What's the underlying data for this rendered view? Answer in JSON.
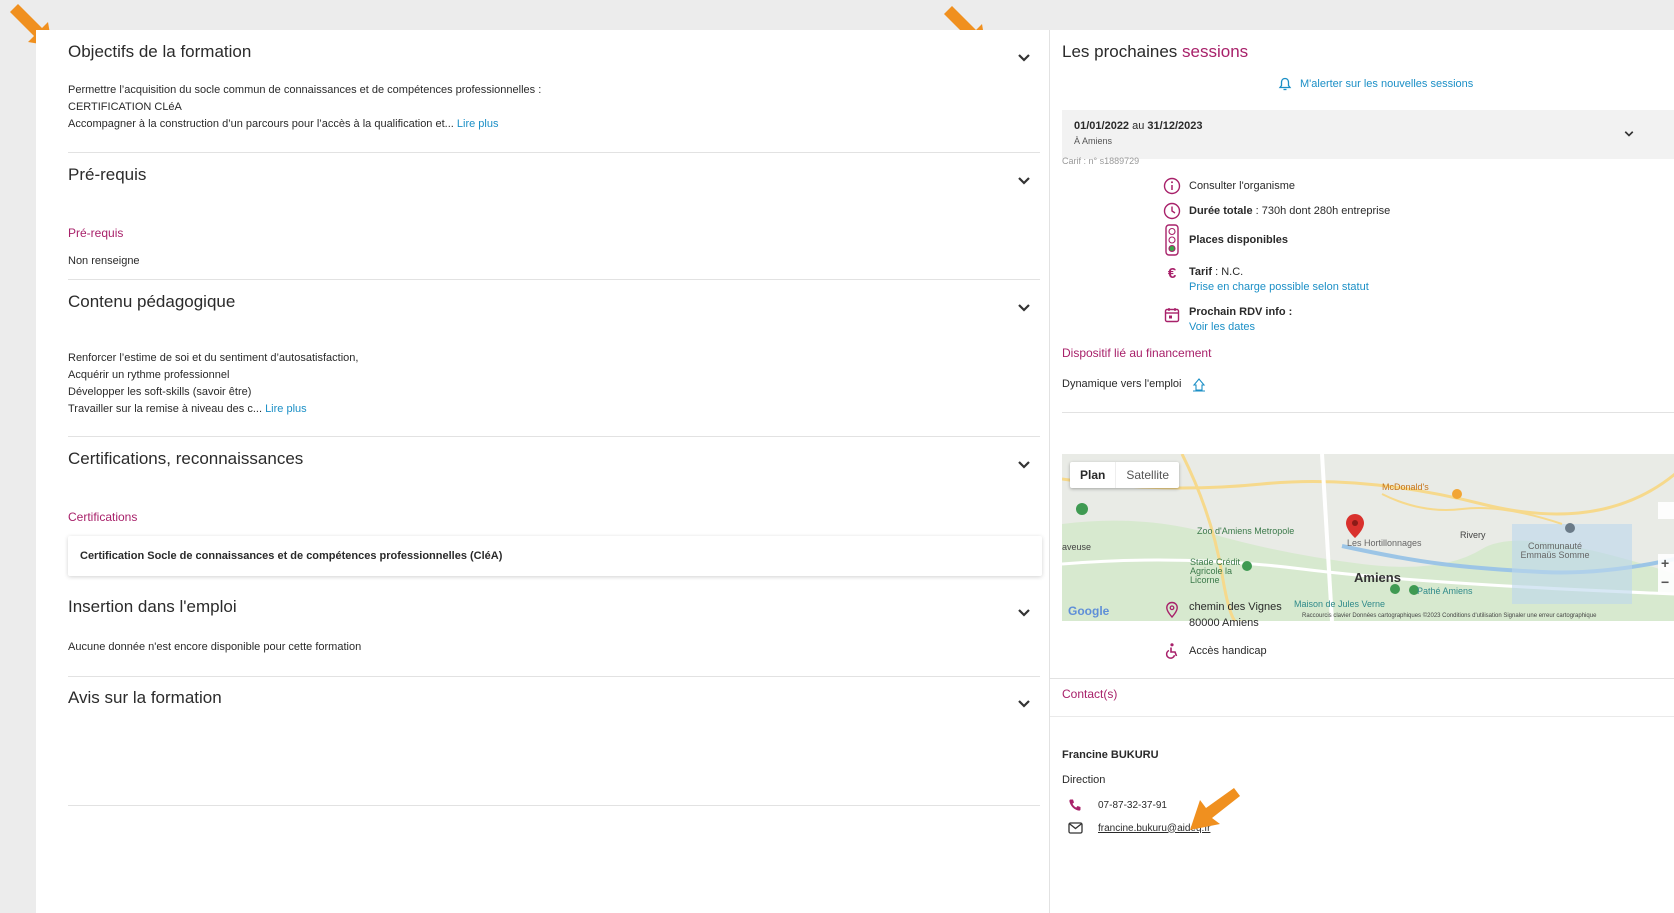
{
  "left": {
    "objectifs": {
      "title": "Objectifs de la formation",
      "line1": "Permettre l’acquisition du socle commun de connaissances et de compétences professionnelles :",
      "line2": "CERTIFICATION CLéA",
      "line3": "Accompagner à la construction d’un parcours pour l’accès à la qualification et...",
      "read_more": "Lire plus"
    },
    "prerequis": {
      "title": "Pré-requis",
      "subtitle": "Pré-requis",
      "value": "Non renseigne"
    },
    "contenu": {
      "title": "Contenu pédagogique",
      "line1": "Renforcer l’estime de soi et du sentiment d’autosatisfaction,",
      "line2": "Acquérir un rythme professionnel",
      "line3": "Développer les soft-skills (savoir être)",
      "line4": "Travailler sur la remise à niveau des c...",
      "read_more": "Lire plus"
    },
    "certifications": {
      "title": "Certifications, reconnaissances",
      "subtitle": "Certifications",
      "card": "Certification Socle de connaissances et de compétences professionnelles (CléA)"
    },
    "insertion": {
      "title": "Insertion dans l'emploi",
      "text": "Aucune donnée n'est encore disponible pour cette formation"
    },
    "avis": {
      "title": "Avis sur la formation"
    }
  },
  "right": {
    "title_part1": "Les prochaines ",
    "title_part2": "sessions",
    "alert_link": "M'alerter sur les nouvelles sessions",
    "session": {
      "date_start": "01/01/2022",
      "date_sep": " au ",
      "date_end": "31/12/2023",
      "location": "À Amiens"
    },
    "carif": "Carif : n° s1889729",
    "consulter": "Consulter l'organisme",
    "duree_label": "Durée totale",
    "duree_value": " : 730h dont 280h entreprise",
    "places": "Places disponibles",
    "tarif_label": "Tarif",
    "tarif_value": " : N.C.",
    "tarif_link": "Prise en charge possible selon statut",
    "rdv_label": "Prochain RDV info :",
    "rdv_link": "Voir les dates",
    "dispositif_title": "Dispositif lié au financement",
    "dispositif_value": "Dynamique vers l'emploi",
    "map": {
      "tab_plan": "Plan",
      "tab_satellite": "Satellite",
      "amiens": "Amiens",
      "rivery": "Rivery",
      "zoo": "Zoo d'Amiens Metropole",
      "stade": "Stade Crédit Agricole la Licorne",
      "pathe": "Pathé Amiens",
      "jules": "Maison de Jules Verne",
      "mcdo": "McDonald's",
      "hortillonnages": "Les Hortillonnages",
      "communaute": "Communauté Emmaüs Somme",
      "google": "Google",
      "footer": "Raccourcis clavier   Données cartographiques ©2023   Conditions d'utilisation   Signaler une erreur cartographique",
      "zoom_in": "+",
      "zoom_out": "−",
      "aveuse": "aveuse"
    },
    "address_line1": "chemin des Vignes",
    "address_line2": "80000 Amiens",
    "handicap": "Accès handicap",
    "contacts_title": "Contact(s)",
    "contact_name": "Francine BUKURU",
    "contact_role": "Direction",
    "contact_phone": "07-87-32-37-91",
    "contact_email": "francine.bukuru@aideq.fr"
  },
  "colors": {
    "accent_magenta": "#a8216a",
    "link_blue": "#1b8fc6",
    "arrow_orange": "#f0901f"
  }
}
